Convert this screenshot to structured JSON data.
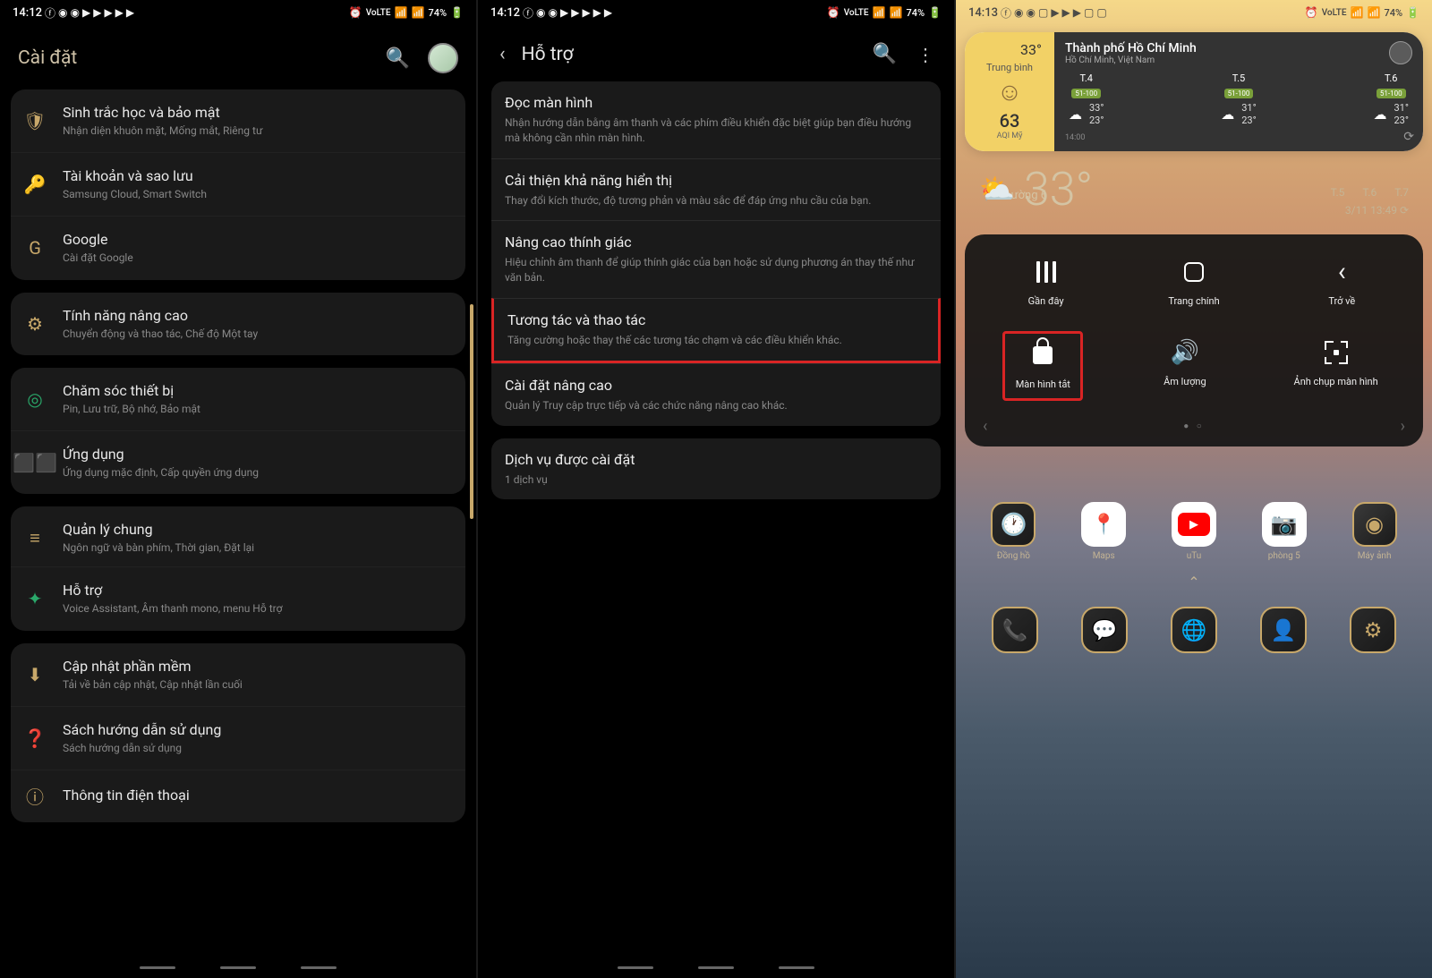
{
  "status": {
    "time1": "14:12",
    "time2": "14:12",
    "time3": "14:13",
    "battery": "74%",
    "lte": "VoLTE"
  },
  "s1": {
    "title": "Cài đặt",
    "groups": [
      {
        "items": [
          {
            "icon": "🛡",
            "color": "#c8a86a",
            "title": "Sinh trắc học và bảo mật",
            "desc": "Nhận diện khuôn mặt, Mống mắt, Riêng tư"
          },
          {
            "icon": "🔑",
            "color": "#c8a86a",
            "title": "Tài khoản và sao lưu",
            "desc": "Samsung Cloud, Smart Switch"
          },
          {
            "icon": "G",
            "color": "#c8a86a",
            "title": "Google",
            "desc": "Cài đặt Google"
          }
        ]
      },
      {
        "items": [
          {
            "icon": "⚙",
            "color": "#c8a86a",
            "title": "Tính năng nâng cao",
            "desc": "Chuyển động và thao tác, Chế độ Một tay"
          }
        ]
      },
      {
        "items": [
          {
            "icon": "◎",
            "color": "#2aa86a",
            "title": "Chăm sóc thiết bị",
            "desc": "Pin, Lưu trữ, Bộ nhớ, Bảo mật"
          },
          {
            "icon": "⬛⬛",
            "color": "#c8a86a",
            "title": "Ứng dụng",
            "desc": "Ứng dụng mặc định, Cấp quyền ứng dụng"
          }
        ]
      },
      {
        "items": [
          {
            "icon": "≡",
            "color": "#c8a86a",
            "title": "Quản lý chung",
            "desc": "Ngôn ngữ và bàn phím, Thời gian, Đặt lại"
          },
          {
            "icon": "✦",
            "color": "#2aa86a",
            "title": "Hỗ trợ",
            "desc": "Voice Assistant, Âm thanh mono, menu Hỗ trợ",
            "hl": true
          }
        ]
      },
      {
        "items": [
          {
            "icon": "⬇",
            "color": "#c8a86a",
            "title": "Cập nhật phần mềm",
            "desc": "Tải về bản cập nhật, Cập nhật lần cuối"
          },
          {
            "icon": "❓",
            "color": "#c8a86a",
            "title": "Sách hướng dẫn sử dụng",
            "desc": "Sách hướng dẫn sử dụng"
          },
          {
            "icon": "ⓘ",
            "color": "#c8a86a",
            "title": "Thông tin điện thoại",
            "desc": ""
          }
        ]
      }
    ]
  },
  "s2": {
    "title": "Hỗ trợ",
    "items": [
      {
        "title": "Đọc màn hình",
        "desc": "Nhận hướng dẫn bằng âm thanh và các phím điều khiển đặc biệt giúp bạn điều hướng mà không cần nhìn màn hình."
      },
      {
        "title": "Cải thiện khả năng hiển thị",
        "desc": "Thay đổi kích thước, độ tương phản và màu sắc để đáp ứng nhu cầu của bạn."
      },
      {
        "title": "Nâng cao thính giác",
        "desc": "Hiệu chỉnh âm thanh để giúp thính giác của bạn hoặc sử dụng phương án thay thế như văn bản."
      },
      {
        "title": "Tương tác và thao tác",
        "desc": "Tăng cường hoặc thay thế các tương tác chạm và các điều khiển khác.",
        "hl": true
      },
      {
        "title": "Cài đặt nâng cao",
        "desc": "Quản lý Truy cập trực tiếp và các chức năng nâng cao khác."
      }
    ],
    "items2": [
      {
        "title": "Dịch vụ được cài đặt",
        "desc": "1 dịch vụ"
      }
    ]
  },
  "s3": {
    "weather": {
      "temp": "33°",
      "status": "Trung bình",
      "aqi": "63",
      "aqi_lbl": "AQI Mỹ",
      "city": "Thành phố Hồ Chí Minh",
      "loc": "Hồ Chí Minh, Việt Nam",
      "time": "14:00",
      "days": [
        {
          "name": "T.4",
          "badge": "51-100",
          "hi": "33°",
          "lo": "23°"
        },
        {
          "name": "T.5",
          "badge": "51-100",
          "hi": "31°",
          "lo": "23°"
        },
        {
          "name": "T.6",
          "badge": "51-100",
          "hi": "31°",
          "lo": "23°"
        }
      ]
    },
    "home": {
      "loc": "Phường 6",
      "temp": "33°",
      "days": [
        "T.5",
        "T.6",
        "T.7"
      ],
      "date": "3/11 13:49"
    },
    "menu": {
      "row1": [
        {
          "lbl": "Gần đây"
        },
        {
          "lbl": "Trang chính"
        },
        {
          "lbl": "Trở về"
        }
      ],
      "row2": [
        {
          "lbl": "Màn hình tắt",
          "hl": true
        },
        {
          "lbl": "Âm lượng"
        },
        {
          "lbl": "Ảnh chụp màn hình"
        }
      ]
    },
    "dock": [
      {
        "lbl": "Đồng hồ"
      },
      {
        "lbl": "Maps"
      },
      {
        "lbl": "uTu"
      },
      {
        "lbl": "phòng 5"
      },
      {
        "lbl": "Máy ảnh"
      }
    ]
  }
}
